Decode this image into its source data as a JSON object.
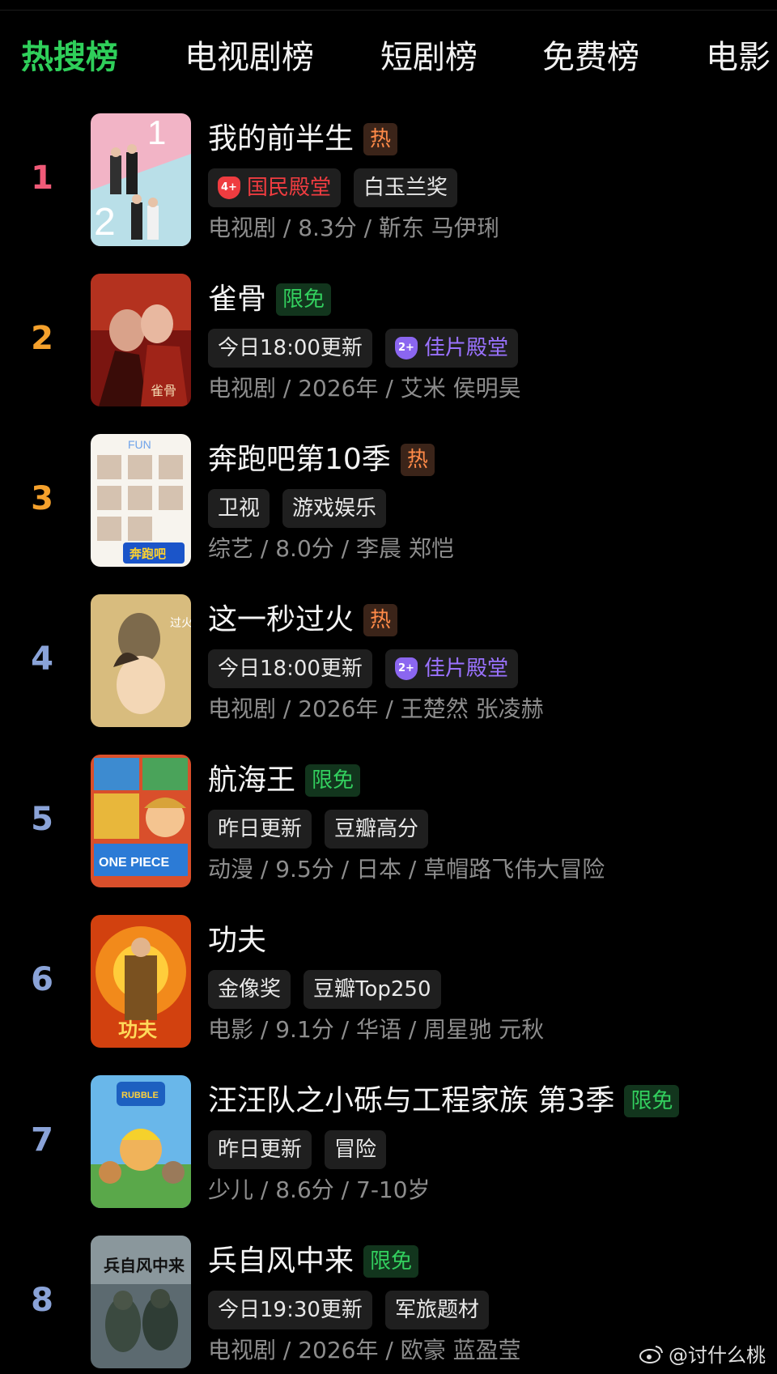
{
  "tabs": [
    "热搜榜",
    "电视剧榜",
    "短剧榜",
    "免费榜",
    "电影"
  ],
  "rank_colors": [
    "#f05a78",
    "#f5a12c",
    "#f5a12c",
    "#8aa3d8",
    "#8aa3d8",
    "#8aa3d8",
    "#8aa3d8",
    "#8aa3d8"
  ],
  "items": [
    {
      "rank": "1",
      "title": "我的前半生",
      "badge": "热",
      "badge_type": "hot",
      "tags": [
        {
          "icon": "4+",
          "text": "国民殿堂",
          "style": "red"
        },
        {
          "text": "白玉兰奖"
        }
      ],
      "meta": "电视剧 / 8.3分 / 靳东 马伊琍"
    },
    {
      "rank": "2",
      "title": "雀骨",
      "badge": "限免",
      "badge_type": "free",
      "tags": [
        {
          "text": "今日18:00更新"
        },
        {
          "icon": "2+",
          "text": "佳片殿堂",
          "style": "purple"
        }
      ],
      "meta": "电视剧 / 2026年 / 艾米 侯明昊"
    },
    {
      "rank": "3",
      "title": "奔跑吧第10季",
      "badge": "热",
      "badge_type": "hot",
      "tags": [
        {
          "text": "卫视"
        },
        {
          "text": "游戏娱乐"
        }
      ],
      "meta": "综艺 / 8.0分 / 李晨 郑恺"
    },
    {
      "rank": "4",
      "title": "这一秒过火",
      "badge": "热",
      "badge_type": "hot",
      "tags": [
        {
          "text": "今日18:00更新"
        },
        {
          "icon": "2+",
          "text": "佳片殿堂",
          "style": "purple"
        }
      ],
      "meta": "电视剧 / 2026年 / 王楚然 张凌赫"
    },
    {
      "rank": "5",
      "title": "航海王",
      "badge": "限免",
      "badge_type": "free",
      "tags": [
        {
          "text": "昨日更新"
        },
        {
          "text": "豆瓣高分"
        }
      ],
      "meta": "动漫 / 9.5分 / 日本 / 草帽路飞伟大冒险"
    },
    {
      "rank": "6",
      "title": "功夫",
      "badge": "",
      "badge_type": "",
      "tags": [
        {
          "text": "金像奖"
        },
        {
          "text": "豆瓣Top250"
        }
      ],
      "meta": "电影 / 9.1分 / 华语 / 周星驰 元秋"
    },
    {
      "rank": "7",
      "title": "汪汪队之小砾与工程家族 第3季",
      "badge": "限免",
      "badge_type": "free",
      "tags": [
        {
          "text": "昨日更新"
        },
        {
          "text": "冒险"
        }
      ],
      "meta": "少儿 / 8.6分 / 7-10岁"
    },
    {
      "rank": "8",
      "title": "兵自风中来",
      "badge": "限免",
      "badge_type": "free",
      "tags": [
        {
          "text": "今日19:30更新"
        },
        {
          "text": "军旅题材"
        }
      ],
      "meta": "电视剧 / 2026年 / 欧豪 蓝盈莹"
    }
  ],
  "poster_art": [
    "romance-drama-poster",
    "costume-drama-poster",
    "variety-show-poster",
    "romance-portrait-poster",
    "anime-collage-poster",
    "kungfu-movie-poster",
    "kids-cartoon-poster",
    "military-drama-poster"
  ],
  "watermark": "@讨什么桃"
}
